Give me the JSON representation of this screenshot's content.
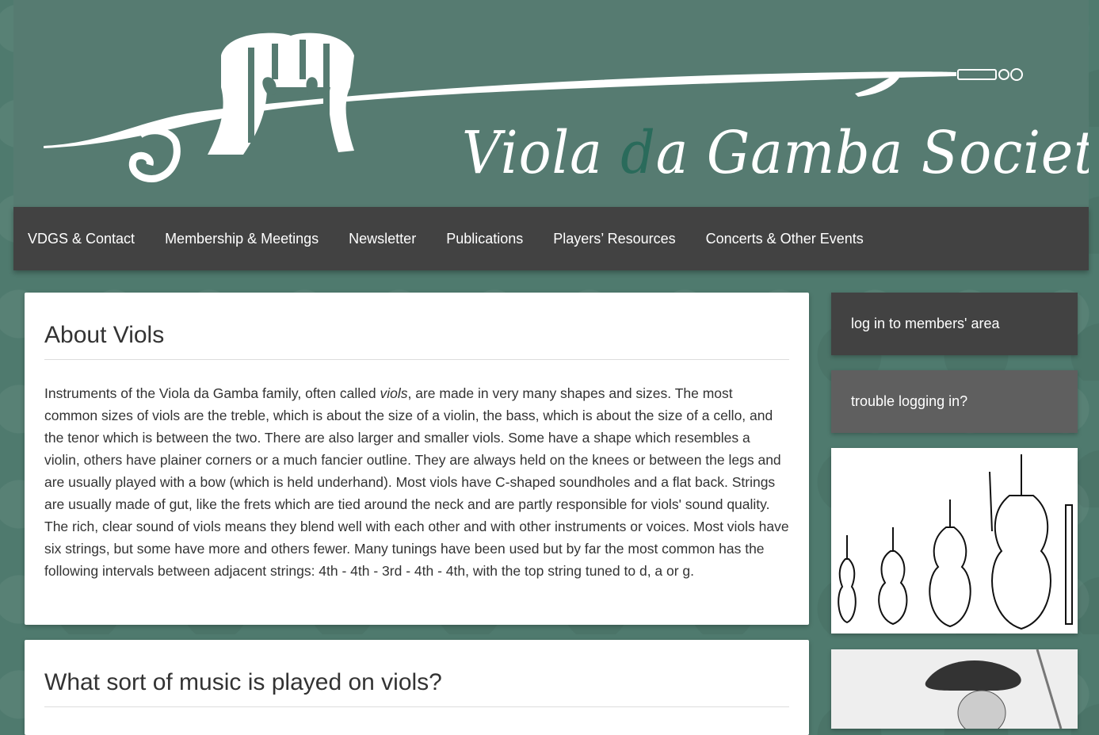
{
  "header": {
    "title_part1": "Viola ",
    "title_accent": "d",
    "title_part2": "a Gamba Society"
  },
  "nav": {
    "items": [
      "VDGS & Contact",
      "Membership & Meetings",
      "Newsletter",
      "Publications",
      "Players’ Resources",
      "Concerts & Other Events"
    ]
  },
  "main": {
    "about": {
      "title": "About Viols",
      "body_before_italic": "Instruments of the Viola da Gamba family, often called ",
      "body_italic": "viols",
      "body_after_italic": ", are made in very many shapes and sizes. The most common sizes of viols are the treble, which is about the size of a violin, the bass, which is about the size of a cello, and the tenor which is between the two. There are also larger and smaller viols. Some have a shape which resembles a violin, others have plainer corners or a much fancier outline. They are always held on the knees or between the legs and are usually played with a bow (which is held underhand). Most viols have C-shaped soundholes and a flat back. Strings are usually made of gut, like the frets which are tied around the neck and are partly responsible for viols' sound quality. The rich, clear sound of viols means they blend well with each other and with other instruments or voices. Most viols have six strings, but some have more and others fewer. Many tunings have been used but by far the most common has the following intervals between adjacent strings: 4th - 4th - 3rd - 4th - 4th, with the top string tuned to d, a or g."
    },
    "music": {
      "title": "What sort of music is played on viols?"
    }
  },
  "sidebar": {
    "login_label": "log in to members' area",
    "trouble_label": "trouble logging in?"
  },
  "colors": {
    "header_bg": "#567b71",
    "page_bg": "#4f7a6e",
    "nav_bg": "#424242",
    "accent_letter": "#2a6b5b"
  }
}
